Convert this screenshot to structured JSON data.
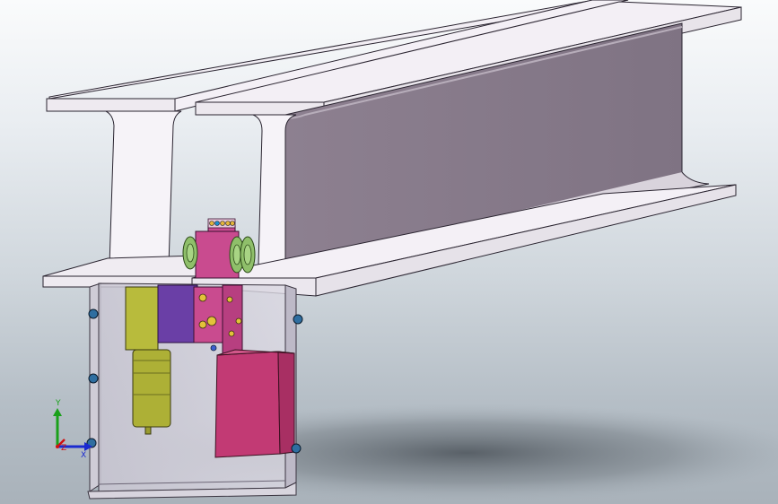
{
  "triad": {
    "y_label": "Y",
    "x_label": "X",
    "z_label": "Z"
  },
  "colors": {
    "beam_top": "#f2eef4",
    "beam_side": "#877a8a",
    "beam_edge": "#2a2430",
    "housing": "#d6d2de",
    "motor": "#b5b83a",
    "purple_block": "#6a3fa6",
    "magenta_box": "#c23a74",
    "mount_plate": "#c94b8f",
    "wheel": "#8fbf6a",
    "bolt": "#2f6ea0",
    "axis_x": "#d01010",
    "axis_y": "#1aa01a",
    "axis_z": "#1a2ad0"
  },
  "icons": {
    "view_triad": "xyz-axis-triad-icon"
  }
}
